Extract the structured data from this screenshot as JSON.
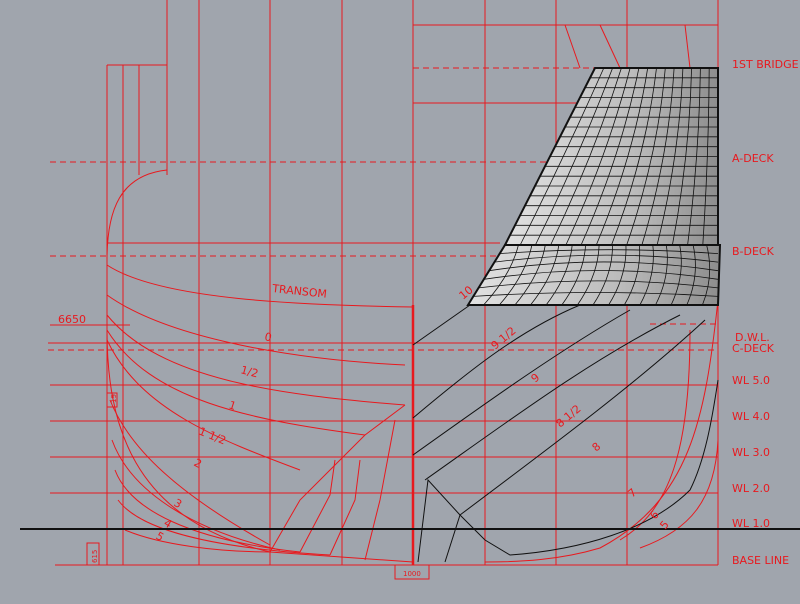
{
  "deck_labels": {
    "first_bridge": "1ST BRIDGE",
    "a_deck": "A-DECK",
    "b_deck": "B-DECK",
    "dwl": "D.W.L.",
    "c_deck": "C-DECK",
    "wl50": "WL 5.0",
    "wl40": "WL 4.0",
    "wl30": "WL 3.0",
    "wl20": "WL 2.0",
    "wl10": "WL 1.0",
    "base": "BASE LINE"
  },
  "station_labels": {
    "transom": "TRANSOM",
    "s0": "0",
    "s_half": "1/2",
    "s1": "1",
    "s1_half": "1 1/2",
    "s2": "2",
    "s3": "3",
    "s4": "4",
    "s5": "5",
    "s10": "10",
    "s9_half": "9 1/2",
    "s9": "9",
    "s8_half": "8 1/2",
    "s8": "8",
    "s7": "7",
    "s6": "6",
    "s5r": "5"
  },
  "dimensions": {
    "height_6650": "6650",
    "small_19": "19",
    "small_615": "615",
    "center_1000": "1000"
  },
  "colors": {
    "background": "#a0a5ad",
    "linework": "#e8191e",
    "mesh": "#111111"
  }
}
